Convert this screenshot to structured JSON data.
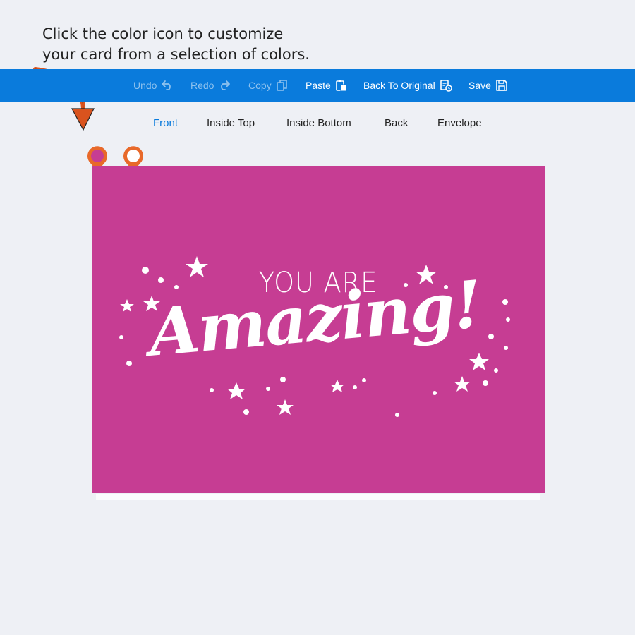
{
  "instruction": {
    "line1": "Click the color icon to customize",
    "line2": "your card from a selection of colors."
  },
  "toolbar": {
    "undo": "Undo",
    "redo": "Redo",
    "copy": "Copy",
    "paste": "Paste",
    "back_to_original": "Back To Original",
    "save": "Save"
  },
  "tabs": [
    "Front",
    "Inside Top",
    "Inside Bottom",
    "Back",
    "Envelope"
  ],
  "active_tab": "Front",
  "card": {
    "line1": "YOU ARE",
    "line2": "Amazing!"
  },
  "colors": {
    "toolbar": "#0a7bdc",
    "card_background": "#c63d93",
    "pin": "#e8692a",
    "arrow": "#d9531e"
  },
  "icons": [
    "undo-icon",
    "redo-icon",
    "copy-icon",
    "paste-icon",
    "history-icon",
    "save-icon",
    "color-pin-icon",
    "image-pin-icon"
  ]
}
